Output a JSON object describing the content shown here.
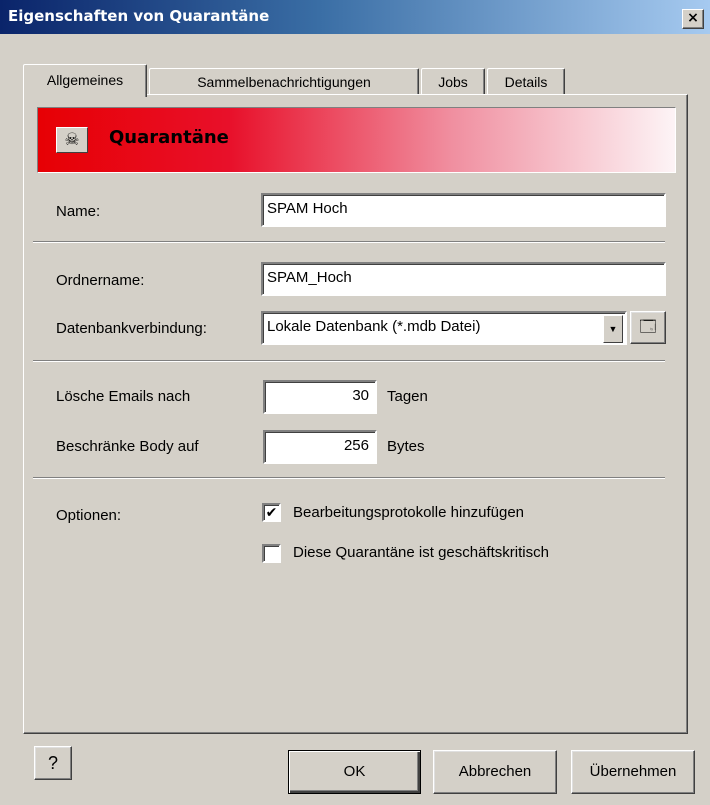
{
  "window": {
    "title": "Eigenschaften von Quarantäne",
    "close_glyph": "×"
  },
  "tabs": [
    {
      "label": "Allgemeines",
      "active": true
    },
    {
      "label": "Sammelbenachrichtigungen",
      "active": false
    },
    {
      "label": "Jobs",
      "active": false
    },
    {
      "label": "Details",
      "active": false
    }
  ],
  "banner": {
    "title": "Quarantäne",
    "icon": "skull-crossbones-icon",
    "gradient_start": "#e70004",
    "gradient_end": "#fdf4f6"
  },
  "form": {
    "name_label": "Name:",
    "name_value": "SPAM Hoch",
    "folder_label": "Ordnername:",
    "folder_value": "SPAM_Hoch",
    "db_label": "Datenbankverbindung:",
    "db_value": "Lokale Datenbank (*.mdb Datei)",
    "delete_label": "Lösche Emails nach",
    "delete_value": "30",
    "delete_unit": "Tagen",
    "body_label": "Beschränke Body auf",
    "body_value": "256",
    "body_unit": "Bytes",
    "options_label": "Optionen:",
    "option1_label": "Bearbeitungsprotokolle hinzufügen",
    "option1_checked": true,
    "option2_label": "Diese Quarantäne ist geschäftskritisch",
    "option2_checked": false
  },
  "buttons": {
    "ok": "OK",
    "cancel": "Abbrechen",
    "apply": "Übernehmen"
  }
}
